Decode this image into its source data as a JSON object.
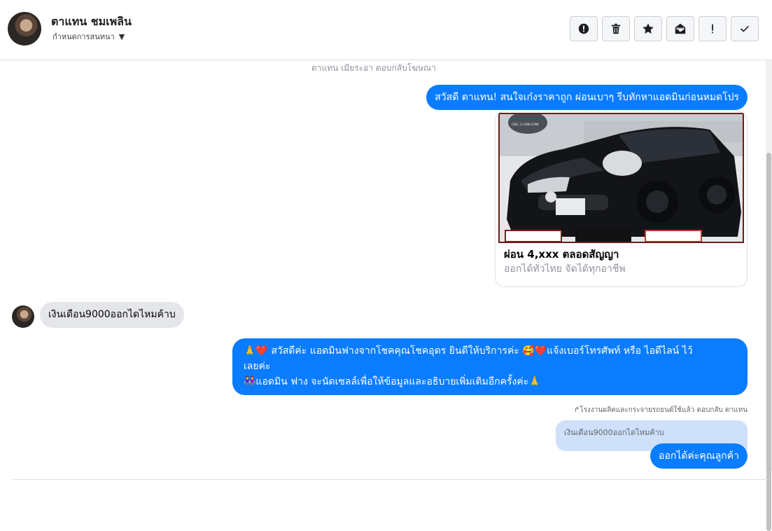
{
  "header": {
    "contact_name": "ตาแทน ชมเพลิน",
    "settings_label": "กำหนดการสนทนา",
    "toolbar": [
      "alert-circle-icon",
      "trash-icon",
      "star-icon",
      "envelope-open-icon",
      "exclamation-icon",
      "check-icon"
    ]
  },
  "messages": {
    "reply_context": "ตาแทน เมียระอา ตอบกลับโฆษณา",
    "greeting": "สวัสดี ตาแทน! สนใจเก๋งราคาถูก ผ่อนเบาๆ รีบทักหาแอดมินก่อนหมดโปร",
    "card": {
      "watermark": "CKC 2 CAR.COM",
      "title": "ผ่อน 4,xxx ตลอดสัญญา",
      "subtitle": "ออกได้ทั่วไทย จัดได้ทุกอาชีพ"
    },
    "incoming": "เงินเดือน9000ออกไดไหมค้าบ",
    "reply_long": {
      "line1": "🙏❤️ สวัสดีค่ะ แอดมินฟางจากโชคคุณโชคอุดร ยินดีให้บริการค่ะ 🥰❤️แจ้งเบอร์โทรศัพท์ หรือ ไอดีไลน์ ไว้",
      "line2": "เลยค่ะ",
      "line3": "👭แอดมิน ฟาง จะนัดเซลล์เพื่อให้ข้อมูลและอธิบายเพิ่มเติมอีกครั้งค่ะ🙏"
    },
    "replied_label": "↱โรงงานผลิตและกระจายรถยนต์ใช้แล้ว ตอบกลับ ตาแทน",
    "quoted_text": "เงินเดือน9000ออกไดไหมค้าบ",
    "final_reply": "ออกได้ค่ะคุณลูกค้า"
  },
  "colors": {
    "outgoing": "#0a7cff",
    "incoming": "#e4e6eb",
    "quoted": "#cfe0fb"
  }
}
